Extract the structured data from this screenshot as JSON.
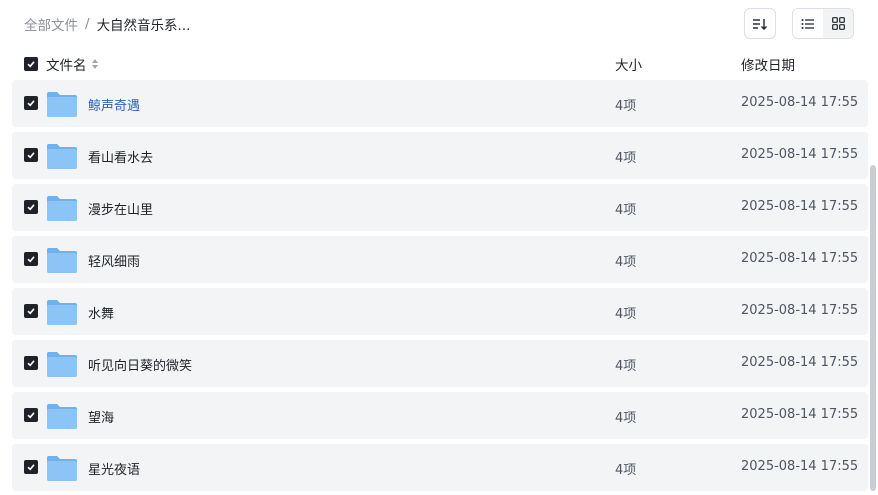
{
  "breadcrumb": {
    "root": "全部文件",
    "separator": "/",
    "current": "大自然音乐系..."
  },
  "columns": {
    "name": "文件名",
    "size": "大小",
    "modified": "修改日期"
  },
  "rows": [
    {
      "name": "鲸声奇遇",
      "size": "4项",
      "date": "2025-08-14 17:55"
    },
    {
      "name": "看山看水去",
      "size": "4项",
      "date": "2025-08-14 17:55"
    },
    {
      "name": "漫步在山里",
      "size": "4项",
      "date": "2025-08-14 17:55"
    },
    {
      "name": "轻风细雨",
      "size": "4项",
      "date": "2025-08-14 17:55"
    },
    {
      "name": "水舞",
      "size": "4项",
      "date": "2025-08-14 17:55"
    },
    {
      "name": "听见向日葵的微笑",
      "size": "4项",
      "date": "2025-08-14 17:55"
    },
    {
      "name": "望海",
      "size": "4项",
      "date": "2025-08-14 17:55"
    },
    {
      "name": "星光夜语",
      "size": "4项",
      "date": "2025-08-14 17:55"
    }
  ],
  "colors": {
    "accent_link": "#2b5fc4",
    "row_bg": "#f3f4f5",
    "folder": "#8cc4f5"
  },
  "icons": {
    "sort": "sort-lines-icon",
    "list_view": "list-view-icon",
    "grid_view": "grid-view-icon",
    "folder": "folder-icon",
    "checkbox": "checkbox-checked-icon"
  }
}
